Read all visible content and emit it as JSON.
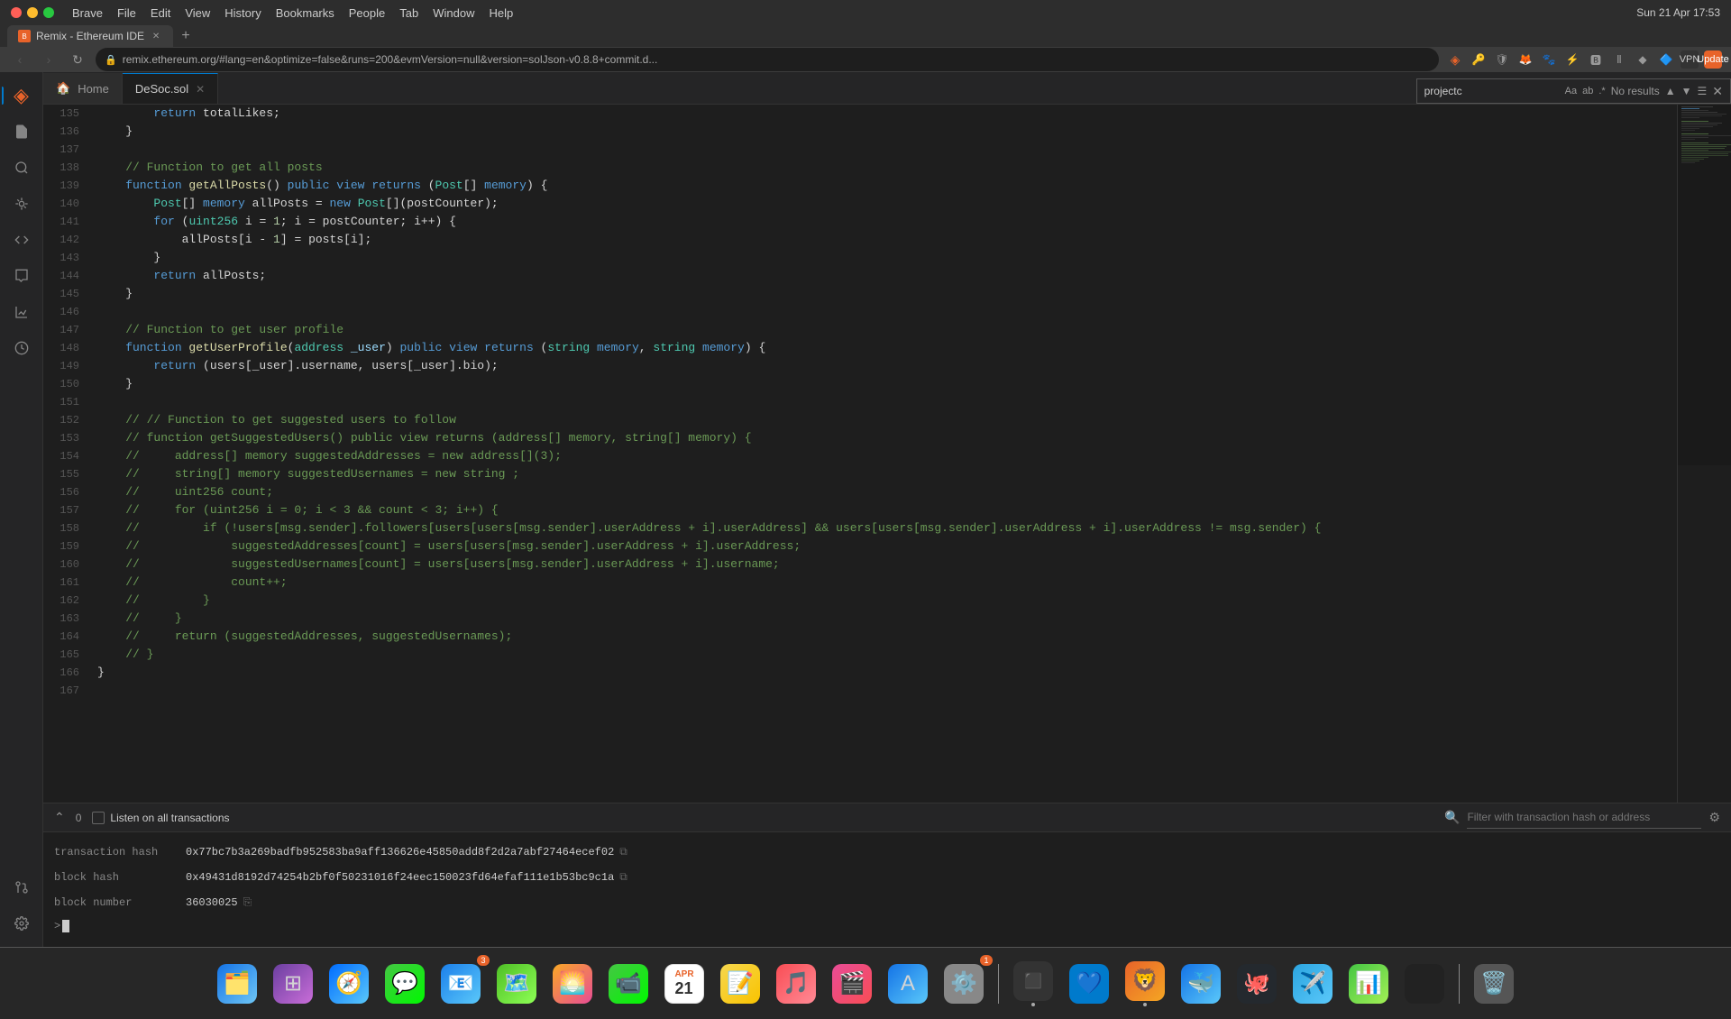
{
  "titlebar": {
    "app": "Brave",
    "menu_items": [
      "Brave",
      "File",
      "Edit",
      "View",
      "History",
      "Bookmarks",
      "People",
      "Tab",
      "Window",
      "Help"
    ],
    "time": "Sun 21 Apr  17:53"
  },
  "browser": {
    "tab_title": "Remix - Ethereum IDE",
    "url": "remix.ethereum.org/#lang=en&optimize=false&runs=200&evmVersion=null&version=solJson-v0.8.8+commit.d...",
    "new_tab_label": "+",
    "back_disabled": false,
    "forward_disabled": false
  },
  "editor": {
    "tabs": [
      {
        "label": "Home",
        "icon": "🏠",
        "active": false,
        "closable": false
      },
      {
        "label": "DeSoc.sol",
        "icon": "",
        "active": true,
        "closable": true
      }
    ],
    "find_placeholder": "projectc",
    "find_result": "No results"
  },
  "code_lines": [
    {
      "num": 135,
      "content": "return totalLikes;"
    },
    {
      "num": 136,
      "content": "}"
    },
    {
      "num": 137,
      "content": ""
    },
    {
      "num": 138,
      "content": "// Function to get all posts"
    },
    {
      "num": 139,
      "content": "function getAllPosts() public view returns (Post[] memory) {"
    },
    {
      "num": 140,
      "content": "    Post[] memory allPosts = new Post[](postCounter);"
    },
    {
      "num": 141,
      "content": "    for (uint256 i = 1; i = postCounter; i++) {"
    },
    {
      "num": 142,
      "content": "        allPosts[i - 1] = posts[i];"
    },
    {
      "num": 143,
      "content": "    }"
    },
    {
      "num": 144,
      "content": "    return allPosts;"
    },
    {
      "num": 145,
      "content": "}"
    },
    {
      "num": 146,
      "content": ""
    },
    {
      "num": 147,
      "content": "// Function to get user profile"
    },
    {
      "num": 148,
      "content": "function getUserProfile(address _user) public view returns (string memory, string memory) {"
    },
    {
      "num": 149,
      "content": "    return (users[_user].username, users[_user].bio);"
    },
    {
      "num": 150,
      "content": "}"
    },
    {
      "num": 151,
      "content": ""
    },
    {
      "num": 152,
      "content": "// // Function to get suggested users to follow"
    },
    {
      "num": 153,
      "content": "// function getSuggestedUsers() public view returns (address[] memory, string[] memory) {"
    },
    {
      "num": 154,
      "content": "//     address[] memory suggestedAddresses = new address[](3);"
    },
    {
      "num": 155,
      "content": "//     string[] memory suggestedUsernames = new string ;"
    },
    {
      "num": 156,
      "content": "//     uint256 count;"
    },
    {
      "num": 157,
      "content": "//     for (uint256 i = 0; i < 3 && count < 3; i++) {"
    },
    {
      "num": 158,
      "content": "//         if (!users[msg.sender].followers[users[users[msg.sender].userAddress + i].userAddress] && users[users[msg.sender].userAddress + i].userAddress != msg.sender) {"
    },
    {
      "num": 159,
      "content": "//             suggestedAddresses[count] = users[users[msg.sender].userAddress + i].userAddress;"
    },
    {
      "num": 160,
      "content": "//             suggestedUsernames[count] = users[users[msg.sender].userAddress + i].username;"
    },
    {
      "num": 161,
      "content": "//             count++;"
    },
    {
      "num": 162,
      "content": "//         }"
    },
    {
      "num": 163,
      "content": "//     }"
    },
    {
      "num": 164,
      "content": "//     return (suggestedAddresses, suggestedUsernames);"
    },
    {
      "num": 165,
      "content": "// }"
    },
    {
      "num": 166,
      "content": "}"
    },
    {
      "num": 167,
      "content": ""
    }
  ],
  "bottom_panel": {
    "tx_count": "0",
    "listen_label": "Listen on all transactions",
    "filter_placeholder": "Filter with transaction hash or address",
    "transaction_hash_label": "transaction hash",
    "transaction_hash_value": "0x77bc7b3a269badfb952583ba9aff136626e45850add8f2d2a7abf27464ecef02",
    "block_hash_label": "block hash",
    "block_hash_value": "0x49431d8192d74254b2bf0f50231016f24eec150023fd64efaf111e1b53bc9c1a",
    "block_number_label": "block number",
    "block_number_value": "36030025",
    "terminal_prompt": ">"
  },
  "activity_icons": [
    {
      "name": "remix-logo",
      "symbol": "◈",
      "active": true
    },
    {
      "name": "file-explorer",
      "symbol": "📄",
      "active": false
    },
    {
      "name": "search",
      "symbol": "🔍",
      "active": false
    },
    {
      "name": "source-control",
      "symbol": "⑃",
      "active": false
    },
    {
      "name": "plugin",
      "symbol": "🔌",
      "active": false
    },
    {
      "name": "debug",
      "symbol": "🐛",
      "active": false
    },
    {
      "name": "analytics",
      "symbol": "📊",
      "active": false
    },
    {
      "name": "transaction",
      "symbol": "⟲",
      "active": false
    },
    {
      "name": "settings-bottom",
      "symbol": "⚙",
      "active": false
    }
  ],
  "dock": {
    "items": [
      {
        "name": "finder",
        "emoji": "🗂️",
        "color": "#1473e6",
        "has_dot": false
      },
      {
        "name": "launchpad",
        "emoji": "🚀",
        "color": "#6b3fa0",
        "has_dot": false
      },
      {
        "name": "safari",
        "emoji": "🧭",
        "color": "#006cff",
        "has_dot": false
      },
      {
        "name": "messages",
        "emoji": "💬",
        "color": "#45c644",
        "has_dot": false
      },
      {
        "name": "mail",
        "emoji": "📧",
        "color": "#1c80ea",
        "badge": "3",
        "has_dot": false
      },
      {
        "name": "maps",
        "emoji": "🗺️",
        "color": "#4fbf26",
        "has_dot": false
      },
      {
        "name": "photos",
        "emoji": "🌅",
        "color": "#e84c96",
        "has_dot": false
      },
      {
        "name": "facetime",
        "emoji": "📹",
        "color": "#45c644",
        "has_dot": false
      },
      {
        "name": "calendar",
        "emoji": "📅",
        "color": "#e8632a",
        "has_dot": false
      },
      {
        "name": "notes",
        "emoji": "📝",
        "color": "#f6d74e",
        "has_dot": false
      },
      {
        "name": "music",
        "emoji": "🎵",
        "color": "#f94d55",
        "has_dot": false
      },
      {
        "name": "itunes",
        "emoji": "🎬",
        "color": "#e84c96",
        "has_dot": false
      },
      {
        "name": "appstore",
        "emoji": "🅐",
        "color": "#1473e6",
        "has_dot": false
      },
      {
        "name": "system-prefs",
        "emoji": "⚙️",
        "color": "#888",
        "badge": "1",
        "has_dot": false
      },
      {
        "name": "terminal",
        "emoji": "⬛",
        "color": "#333",
        "has_dot": true
      },
      {
        "name": "vscode",
        "emoji": "💙",
        "color": "#007acc",
        "has_dot": false
      },
      {
        "name": "brave",
        "emoji": "🦁",
        "color": "#e8632a",
        "has_dot": true
      },
      {
        "name": "docker",
        "emoji": "🐳",
        "color": "#1473e6",
        "has_dot": false
      },
      {
        "name": "github",
        "emoji": "🐙",
        "color": "#333",
        "has_dot": false
      },
      {
        "name": "telegram",
        "emoji": "✈️",
        "color": "#2ca5e0",
        "has_dot": false
      },
      {
        "name": "numbers",
        "emoji": "🔢",
        "color": "#45c644",
        "has_dot": false
      },
      {
        "name": "dark-rect",
        "emoji": "⬛",
        "color": "#222",
        "has_dot": false
      },
      {
        "name": "trash",
        "emoji": "🗑️",
        "color": "#888",
        "has_dot": false
      }
    ]
  }
}
